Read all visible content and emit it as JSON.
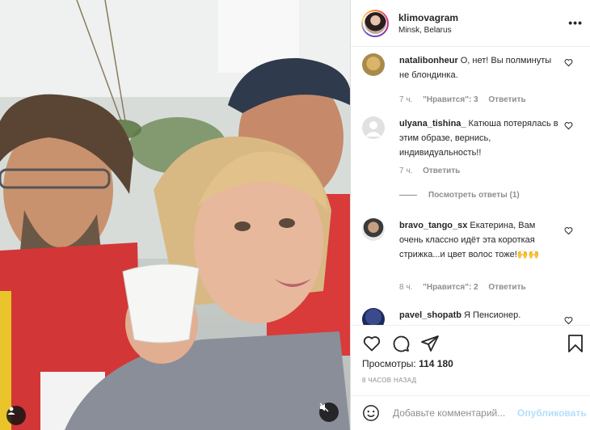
{
  "post": {
    "username": "klimovagram",
    "location": "Minsk, Belarus"
  },
  "comments": [
    {
      "user": "natalibonheur",
      "text": "О, нет! Вы полминуты не блондинка.",
      "time": "7 ч.",
      "likes": "\"Нравится\": 3",
      "reply": "Ответить"
    },
    {
      "user": "ulyana_tishina_",
      "text": "Катюша потерялась в этим образе, вернись, индивидуальность!!",
      "time": "7 ч.",
      "reply": "Ответить",
      "view_replies": "Посмотреть ответы (1)"
    },
    {
      "user": "bravo_tango_sx",
      "text": "Екатерина, Вам очень классно идёт эта короткая стрижка...и цвет волос тоже!🙌🙌",
      "time": "8 ч.",
      "likes": "\"Нравится\": 2",
      "reply": "Ответить"
    },
    {
      "user": "pavel_shopatb",
      "text": "Я Пенсионер."
    }
  ],
  "stats": {
    "views_label": "Просмотры:",
    "views_count": "114 180",
    "posted": "8 ЧАСОВ НАЗАД"
  },
  "composer": {
    "placeholder": "Добавьте комментарий...",
    "publish": "Опубликовать"
  },
  "icons": {
    "like": "heart-icon",
    "comment": "comment-icon",
    "share": "paper-plane-icon",
    "save": "bookmark-icon",
    "more": "more-icon",
    "emoji": "emoji-icon",
    "mute": "speaker-muted-icon",
    "tagged": "user-tag-icon"
  }
}
